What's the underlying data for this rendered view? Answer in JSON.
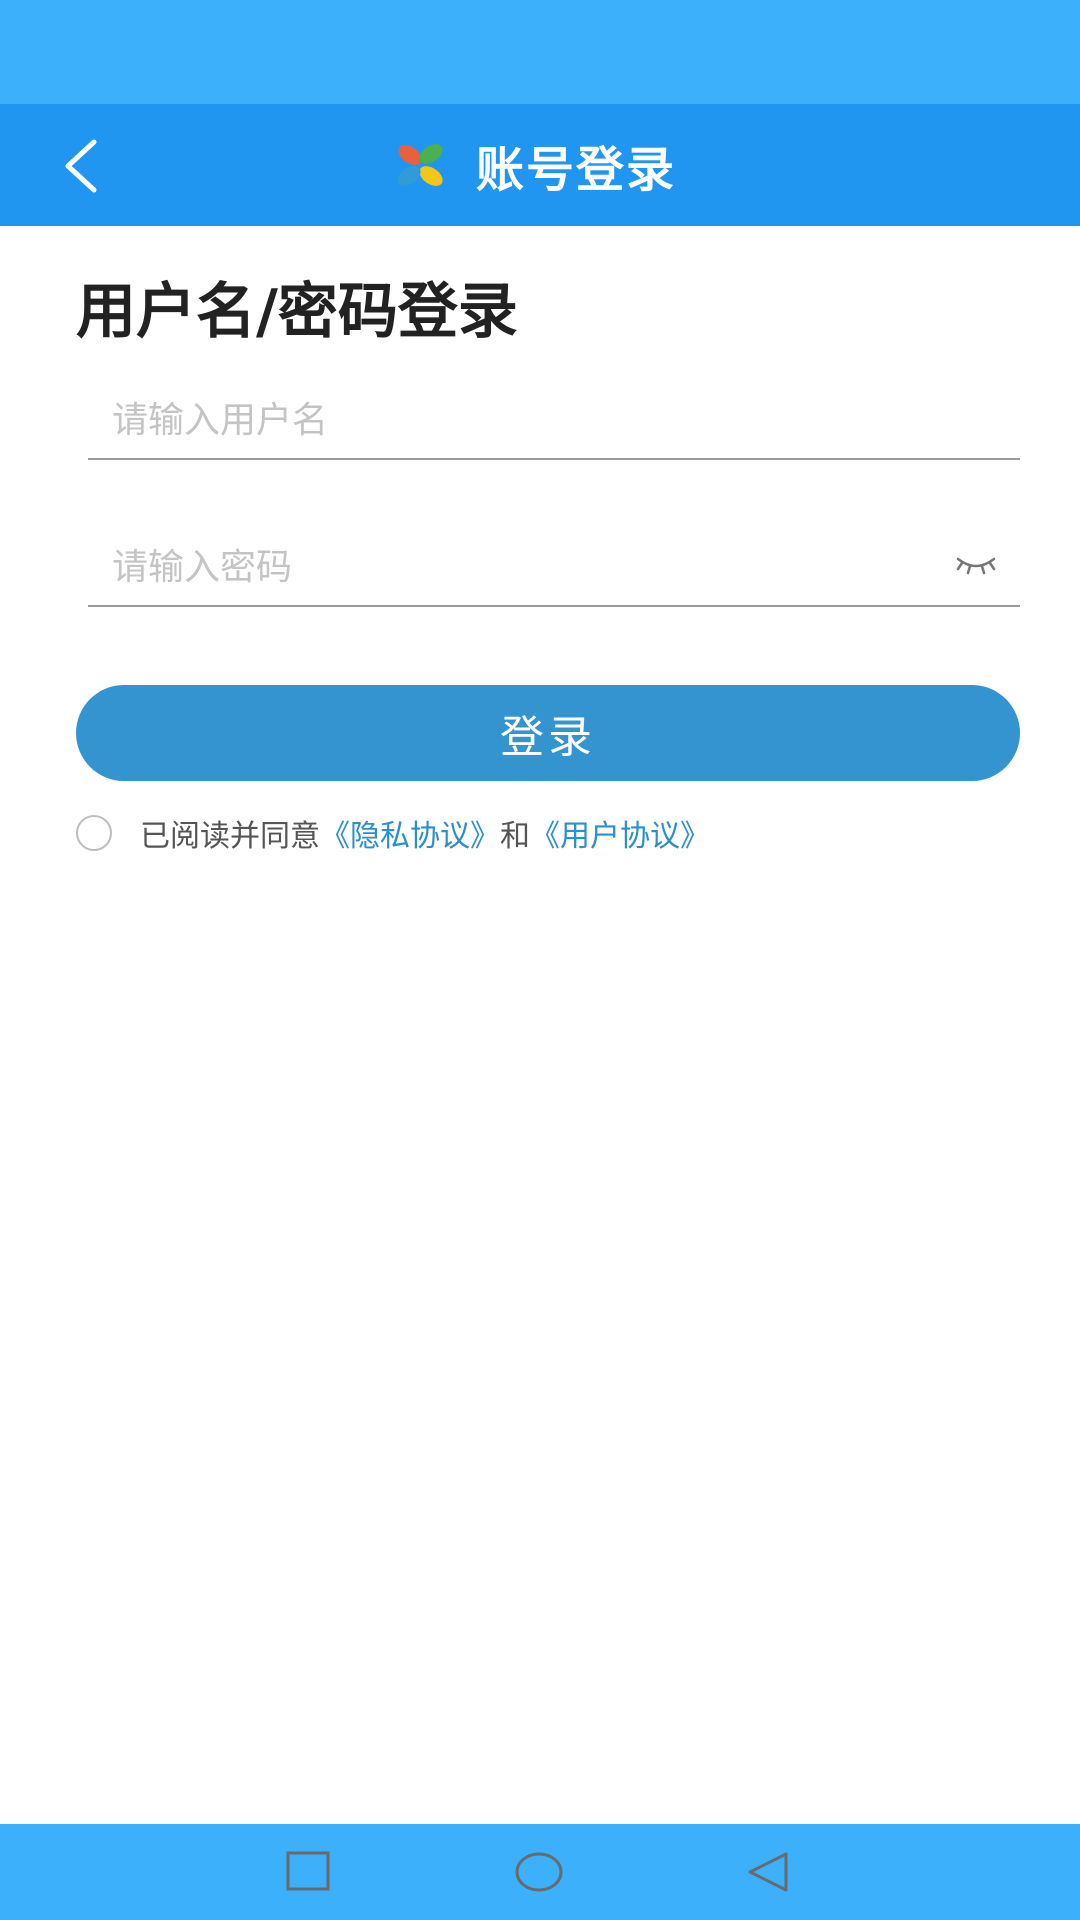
{
  "app_bar": {
    "title": "账号登录",
    "back_icon": "chevron-left-icon",
    "logo_icon": "pinwheel-logo-icon",
    "logo_colors": [
      "#e8603c",
      "#f5c518",
      "#4caf50",
      "#2f9bd8"
    ]
  },
  "page": {
    "heading": "用户名/密码登录"
  },
  "form": {
    "username_placeholder": "请输入用户名",
    "username_value": "",
    "password_placeholder": "请输入密码",
    "password_value": "",
    "password_toggle_icon": "eye-closed-icon",
    "login_label": "登录"
  },
  "agreement": {
    "checked": false,
    "prefix": "已阅读并同意",
    "privacy_link": "《隐私协议》",
    "joiner": "和",
    "user_link": "《用户协议》"
  },
  "nav_bar": {
    "recents_icon": "square-icon",
    "home_icon": "circle-icon",
    "back_icon": "triangle-back-icon"
  },
  "colors": {
    "status_bar": "#3cb0fb",
    "app_bar": "#2096f0",
    "button": "#3494d0",
    "link": "#2b8fcf"
  }
}
